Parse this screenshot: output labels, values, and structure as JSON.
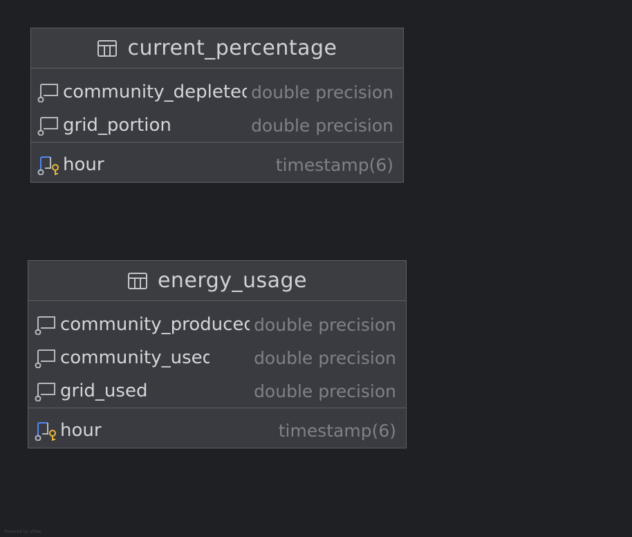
{
  "tables": [
    {
      "name": "current_percentage",
      "columns": [
        {
          "name": "community_depleted",
          "type": "double precision"
        },
        {
          "name": "grid_portion",
          "type": "double precision"
        }
      ],
      "primary_key": {
        "name": "hour",
        "type": "timestamp(6)"
      }
    },
    {
      "name": "energy_usage",
      "columns": [
        {
          "name": "community_produced",
          "type": "double precision"
        },
        {
          "name": "community_used",
          "type": "double precision"
        },
        {
          "name": "grid_used",
          "type": "double precision"
        }
      ],
      "primary_key": {
        "name": "hour",
        "type": "timestamp(6)"
      }
    }
  ],
  "icons": {
    "table": "table-icon",
    "column": "column-icon",
    "primary_key": "primary-key-column-icon"
  },
  "colors": {
    "background": "#1f2024",
    "card": "#393b40",
    "key_blue": "#4f87f5",
    "key_gold": "#e8b838"
  },
  "watermark": "Powered by yFiles"
}
